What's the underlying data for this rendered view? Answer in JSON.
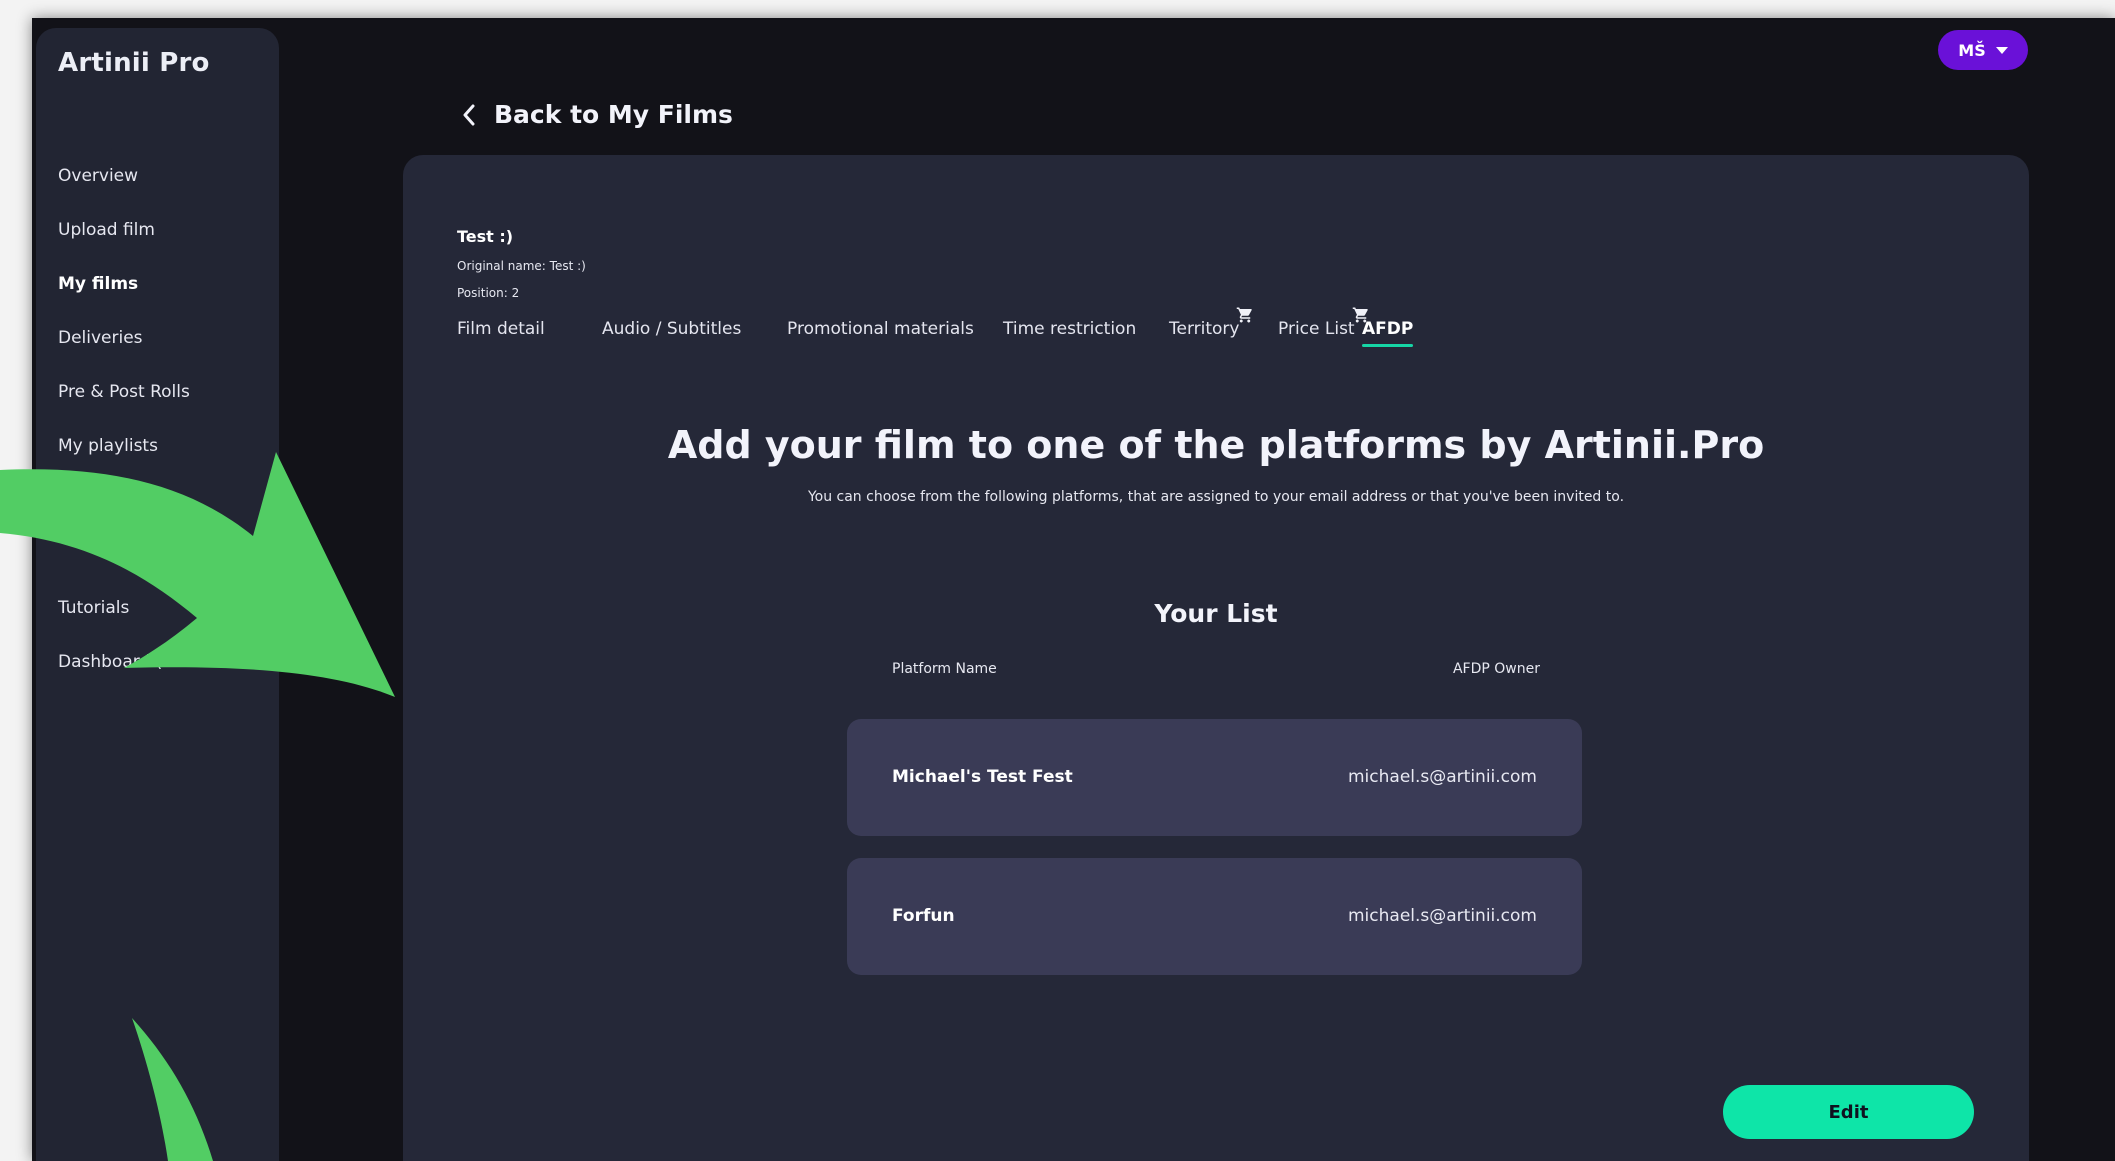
{
  "app": {
    "logo_text": "Artinii Pro"
  },
  "sidebar": {
    "items": [
      {
        "label": "Overview"
      },
      {
        "label": "Upload film"
      },
      {
        "label": "My films"
      },
      {
        "label": "Deliveries"
      },
      {
        "label": "Pre & Post Rolls"
      },
      {
        "label": "My playlists"
      },
      {
        "label": "Tutorials"
      },
      {
        "label": "Dashboard (le"
      }
    ]
  },
  "user": {
    "initials": "MŠ"
  },
  "back": {
    "label": "Back to My Films"
  },
  "film": {
    "title": "Test :)",
    "original_name": "Original name: Test :)",
    "position": "Position: 2"
  },
  "tabs": [
    {
      "label": "Film detail"
    },
    {
      "label": "Audio / Subtitles"
    },
    {
      "label": "Promotional materials"
    },
    {
      "label": "Time restriction"
    },
    {
      "label": "Territory"
    },
    {
      "label": "Price List"
    },
    {
      "label": "AFDP"
    }
  ],
  "afdp": {
    "heading": "Add your film to one of the platforms by Artinii.Pro",
    "subheading": "You can choose from the following platforms, that are assigned to your email address or that you've been invited to.",
    "list_title": "Your List",
    "columns": {
      "platform": "Platform Name",
      "owner": "AFDP Owner"
    },
    "rows": [
      {
        "name": "Michael's Test Fest",
        "owner": "michael.s@artinii.com"
      },
      {
        "name": "Forfun",
        "owner": "michael.s@artinii.com"
      }
    ],
    "edit_label": "Edit"
  },
  "colors": {
    "accent": "#0ee5a8",
    "user_badge": "#6a11d8",
    "annotation_arrow": "#52cd64"
  }
}
